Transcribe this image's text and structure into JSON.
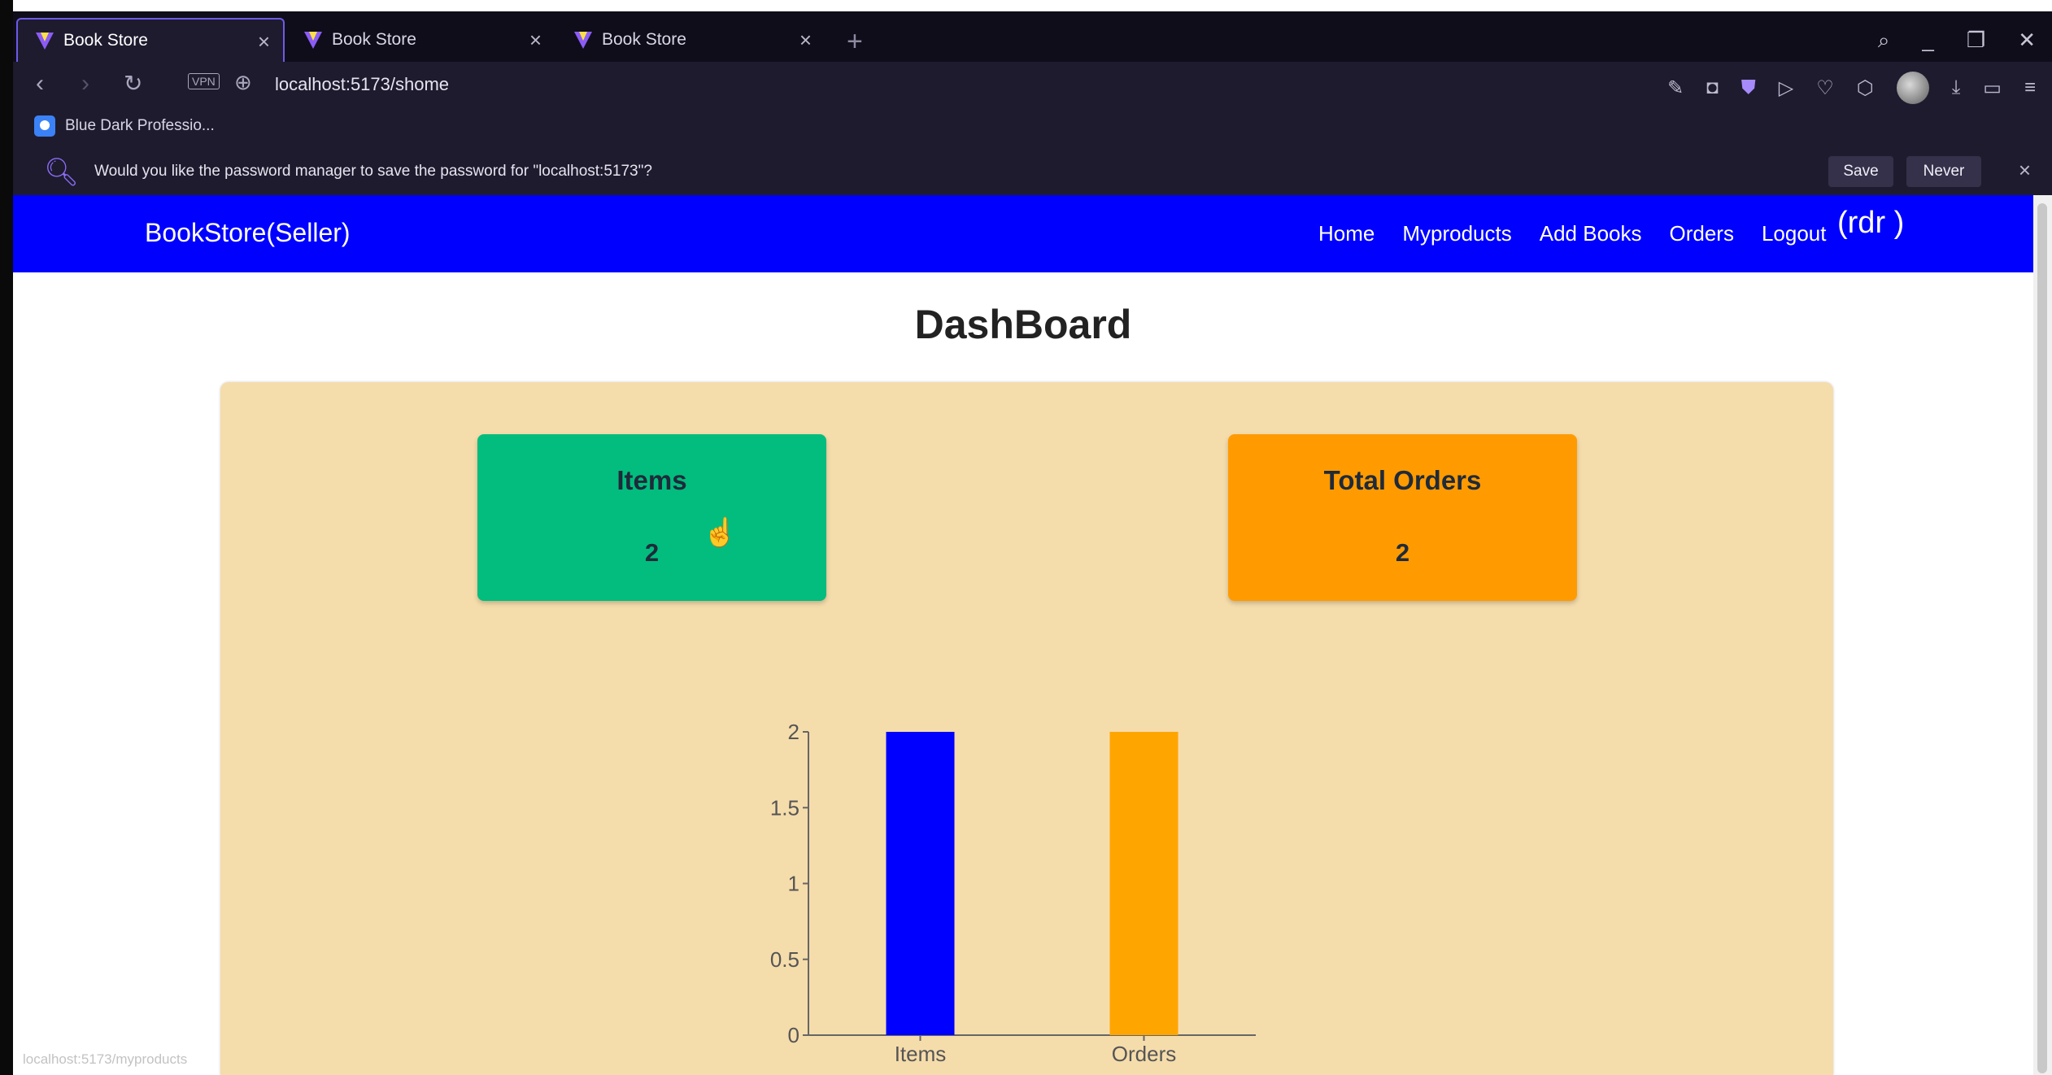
{
  "browser": {
    "tabs": [
      {
        "title": "Book Store",
        "active": true
      },
      {
        "title": "Book Store",
        "active": false
      },
      {
        "title": "Book Store",
        "active": false
      }
    ],
    "address": "localhost:5173/shome",
    "vpn_label": "VPN",
    "bookmark": "Blue Dark Professio...",
    "password_prompt": {
      "text": "Would you like the password manager to save the password for \"localhost:5173\"?",
      "save_label": "Save",
      "never_label": "Never"
    },
    "status_hint": "localhost:5173/myproducts"
  },
  "navbar": {
    "brand": "BookStore(Seller)",
    "links": [
      "Home",
      "Myproducts",
      "Add Books",
      "Orders",
      "Logout"
    ],
    "user": "(rdr )",
    "color": "#0000ff"
  },
  "page": {
    "title": "DashBoard"
  },
  "cards": [
    {
      "title": "Items",
      "value": "2",
      "color": "#02bd7e"
    },
    {
      "title": "Total Orders",
      "value": "2",
      "color": "#ff9b00"
    }
  ],
  "chart_data": {
    "type": "bar",
    "categories": [
      "Items",
      "Orders"
    ],
    "values": [
      2,
      2
    ],
    "colors": [
      "#0000ff",
      "#ffa500"
    ],
    "ylim": [
      0,
      2
    ],
    "yticks": [
      "0",
      "0.5",
      "1",
      "1.5",
      "2"
    ],
    "grid": false
  }
}
